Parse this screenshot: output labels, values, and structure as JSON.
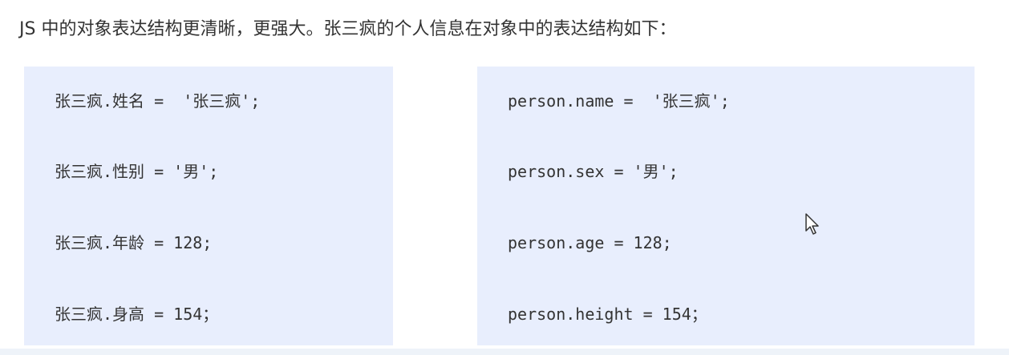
{
  "intro_text": "JS 中的对象表达结构更清晰，更强大。张三疯的个人信息在对象中的表达结构如下：",
  "left_panel": {
    "lines": [
      "张三疯.姓名 =  '张三疯';",
      "张三疯.性别 = '男';",
      "张三疯.年龄 = 128;",
      "张三疯.身高 = 154；"
    ]
  },
  "right_panel": {
    "lines": [
      "person.name =  '张三疯';",
      "person.sex = '男';",
      "person.age = 128;",
      "person.height = 154；"
    ]
  },
  "colors": {
    "panel_bg": "#e8eefd",
    "text": "#333333"
  },
  "icons": {
    "cursor": "mouse-pointer-icon"
  }
}
